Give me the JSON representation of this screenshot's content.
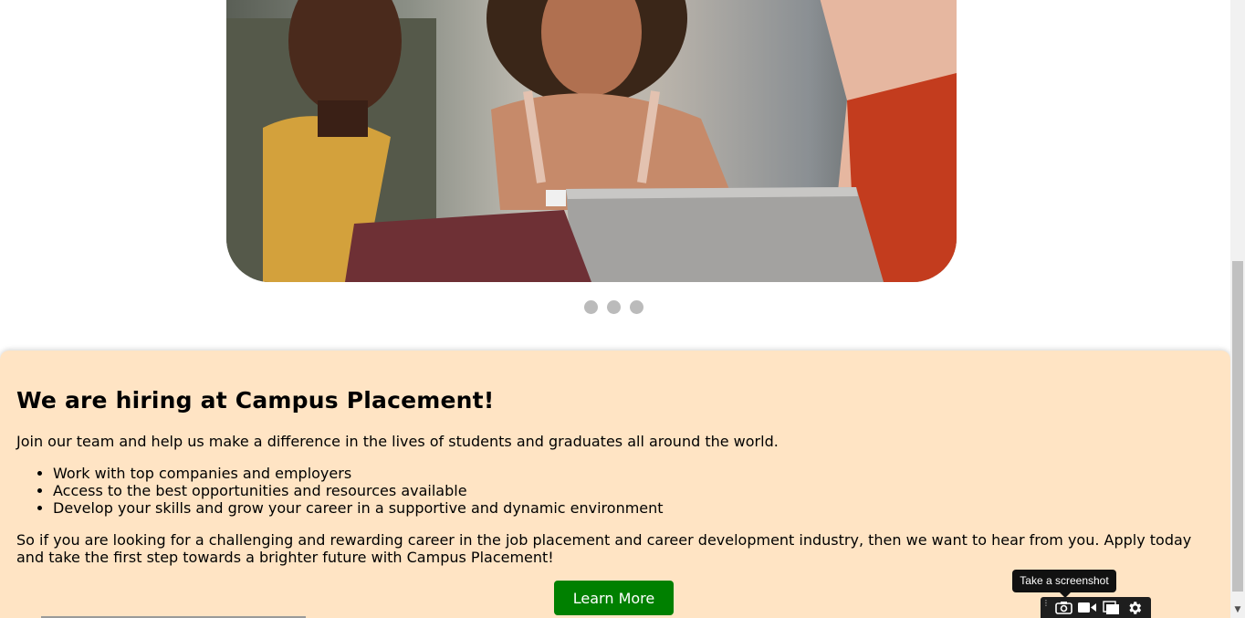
{
  "hiring": {
    "heading": "We are hiring at Campus Placement!",
    "intro": "Join our team and help us make a difference in the lives of students and graduates all around the world.",
    "bullets": [
      "Work with top companies and employers",
      "Access to the best opportunities and resources available",
      "Develop your skills and grow your career in a supportive and dynamic environment"
    ],
    "closing": "So if you are looking for a challenging and rewarding career in the job placement and career development industry, then we want to hear from you. Apply today and take the first step towards a brighter future with Campus Placement!",
    "button_label": "Learn More",
    "button_color": "#008000",
    "card_color": "#ffe4c4"
  },
  "carousel": {
    "slide_count": 3,
    "dot_color": "#bbbbbb"
  },
  "toolbar": {
    "tooltip": "Take a screenshot",
    "tools": [
      "camera-icon",
      "video-icon",
      "window-icon",
      "gear-icon"
    ]
  }
}
